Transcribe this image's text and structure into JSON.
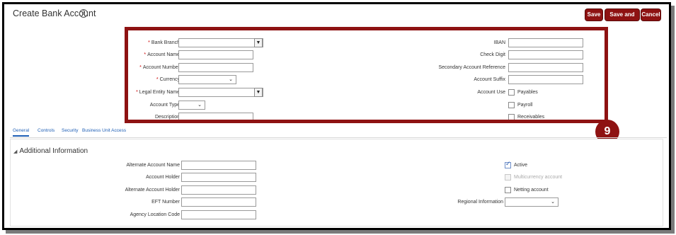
{
  "header": {
    "title": "Create Bank Account",
    "help_glyph": "?",
    "buttons": {
      "save": "Save",
      "save_and_close": "Save and Close",
      "cancel": "Cancel"
    }
  },
  "step_badge": "9",
  "account_form": {
    "left": [
      {
        "label": "Bank Branch",
        "required": "*",
        "type": "choice-list"
      },
      {
        "label": "Account Name",
        "required": "*",
        "type": "text",
        "value": ""
      },
      {
        "label": "Account Number",
        "required": "*",
        "type": "text",
        "value": ""
      },
      {
        "label": "Currency",
        "required": "*",
        "type": "select"
      },
      {
        "label": "Legal Entity Name",
        "required": "*",
        "type": "choice-list"
      },
      {
        "label": "Account Type",
        "required": "",
        "type": "select"
      },
      {
        "label": "Description",
        "required": "",
        "type": "text",
        "value": ""
      }
    ],
    "right": [
      {
        "label": "IBAN",
        "value": ""
      },
      {
        "label": "Check Digit",
        "value": ""
      },
      {
        "label": "Secondary Account Reference",
        "value": ""
      },
      {
        "label": "Account Suffix",
        "value": ""
      }
    ],
    "account_use": {
      "label": "Account Use",
      "options": [
        {
          "label": "Payables",
          "checked": false
        },
        {
          "label": "Payroll",
          "checked": false
        },
        {
          "label": "Receivables",
          "checked": false
        }
      ]
    }
  },
  "tabs": [
    "General",
    "Controls",
    "Security",
    "Business Unit Access"
  ],
  "active_tab": "General",
  "additional_info": {
    "title": "Additional Information",
    "left": [
      {
        "label": "Alternate Account Name",
        "value": ""
      },
      {
        "label": "Account Holder",
        "value": ""
      },
      {
        "label": "Alternate Account Holder",
        "value": ""
      },
      {
        "label": "EFT Number",
        "value": ""
      },
      {
        "label": "Agency Location Code",
        "value": ""
      }
    ],
    "right": [
      {
        "label": "Active",
        "checked": true,
        "disabled": false
      },
      {
        "label": "Multicurrency account",
        "checked": false,
        "disabled": true
      },
      {
        "label": "Netting account",
        "checked": false,
        "disabled": false
      }
    ],
    "regional_information": {
      "label": "Regional Information",
      "value": ""
    }
  },
  "colors": {
    "accent": "#8e1212",
    "link": "#1f5fb5",
    "required": "#cc0000"
  },
  "icons": {
    "help": "help-icon",
    "dropdown": "chevron-down-icon",
    "checkmark": "checkmark-icon"
  }
}
